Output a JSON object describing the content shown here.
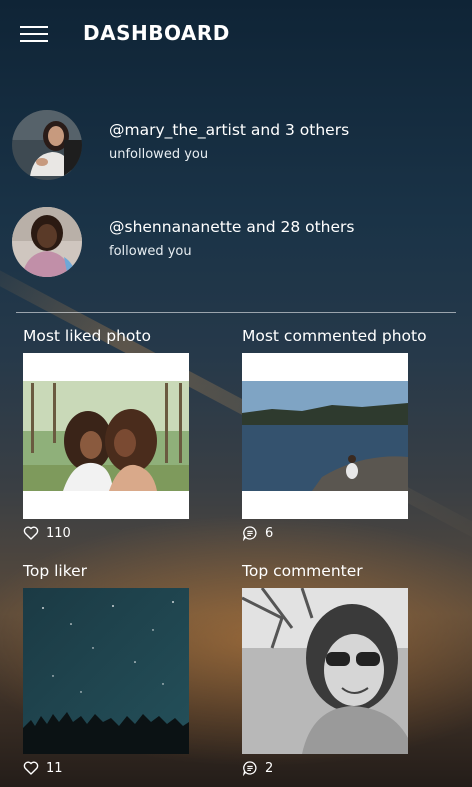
{
  "header": {
    "title": "DASHBOARD",
    "menu_icon": "hamburger-menu-icon"
  },
  "activities": [
    {
      "handle": "@mary_the_artist and 3 others",
      "action": "unfollowed you"
    },
    {
      "handle": "@shennananette and 28 others",
      "action": "followed you"
    }
  ],
  "tiles": {
    "most_liked": {
      "label": "Most liked photo",
      "count": "110",
      "icon": "heart-icon"
    },
    "most_commented": {
      "label": "Most commented photo",
      "count": "6",
      "icon": "comment-icon"
    },
    "top_liker": {
      "label": "Top liker",
      "count": "11",
      "icon": "heart-icon"
    },
    "top_commenter": {
      "label": "Top commenter",
      "count": "2",
      "icon": "comment-icon"
    }
  }
}
